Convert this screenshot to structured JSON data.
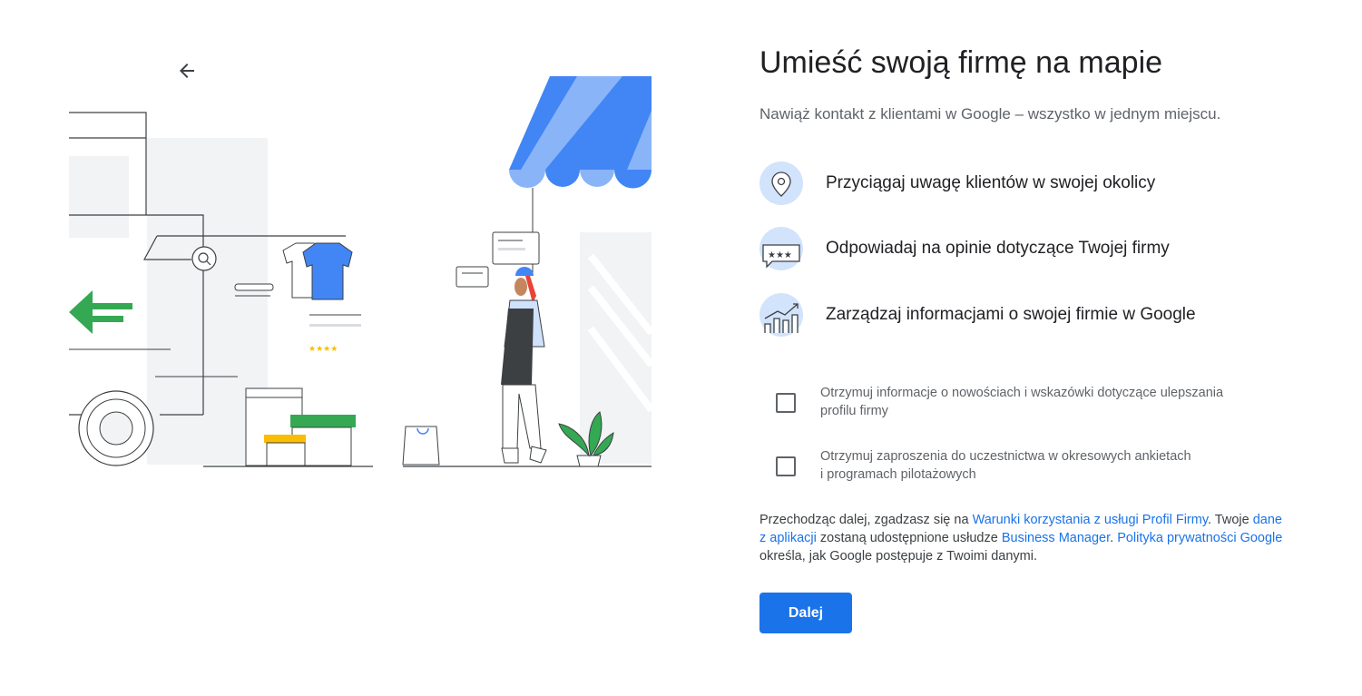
{
  "header": {
    "title": "Umieść swoją firmę na mapie",
    "subtitle": "Nawiąż kontakt z klientami w Google – wszystko w jednym miejscu."
  },
  "features": [
    {
      "icon": "location-pin-icon",
      "label": "Przyciągaj uwagę klientów w swojej okolicy"
    },
    {
      "icon": "review-stars-icon",
      "label": "Odpowiadaj na opinie dotyczące Twojej firmy"
    },
    {
      "icon": "growth-chart-icon",
      "label": "Zarządzaj informacjami o swojej firmie w Google"
    }
  ],
  "checkboxes": [
    {
      "line1": "Otrzymuj informacje o nowościach i wskazówki dotyczące ulepszania",
      "line2": "profilu firmy",
      "checked": false
    },
    {
      "line1": "Otrzymuj zaproszenia do uczestnictwa w okresowych ankietach",
      "line2": "i programach pilotażowych",
      "checked": false
    }
  ],
  "legal": {
    "t1": "Przechodząc dalej, zgadzasz się na ",
    "link_terms": "Warunki korzystania z usługi Profil Firmy",
    "t2": ". Twoje ",
    "link_data": "dane z aplikacji",
    "t3": " zostaną udostępnione usłudze ",
    "link_bm": "Business Manager",
    "t4": ". ",
    "link_privacy": "Polityka prywatności Google",
    "t5": " określa, jak Google postępuje z Twoimi danymi."
  },
  "actions": {
    "next_label": "Dalej"
  },
  "colors": {
    "accent": "#1a73e8",
    "brand_blue": "#4285f4",
    "brand_green": "#34a853",
    "brand_yellow": "#fbbc04",
    "icon_bg": "#d2e3fc"
  }
}
